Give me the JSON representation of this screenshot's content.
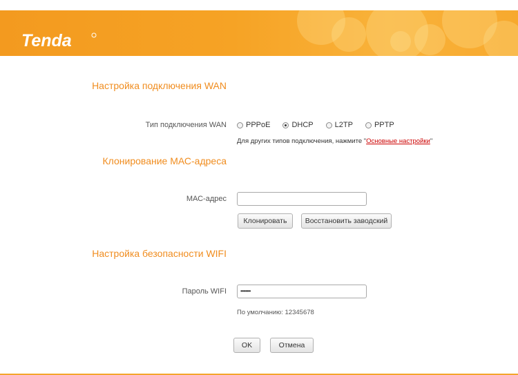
{
  "brand": {
    "logo_text": "Tenda",
    "accent_color": "#f39a1f",
    "title_color": "#f08c1e"
  },
  "wan": {
    "title": "Настройка подключения WAN",
    "connection_type_label": "Тип подключения WAN",
    "options": [
      {
        "label": "PPPoE",
        "selected": false
      },
      {
        "label": "DHCP",
        "selected": true
      },
      {
        "label": "L2TP",
        "selected": false
      },
      {
        "label": "PPTP",
        "selected": false
      }
    ],
    "hint_prefix": "Для других типов подключения, нажмите \"",
    "hint_link": "Основные настройки",
    "hint_suffix": "\""
  },
  "mac": {
    "title": "Клонирование МАС-адреса",
    "label": "МАС-адрес",
    "value": "",
    "clone_button": "Клонировать",
    "restore_button": "Восстановить заводский"
  },
  "wifi": {
    "title": "Настройка безопасности WIFI",
    "label": "Пароль WIFI",
    "password_mask": "••••••••",
    "default_note": "По умолчанию: 12345678"
  },
  "actions": {
    "ok": "OK",
    "cancel": "Отмена"
  }
}
